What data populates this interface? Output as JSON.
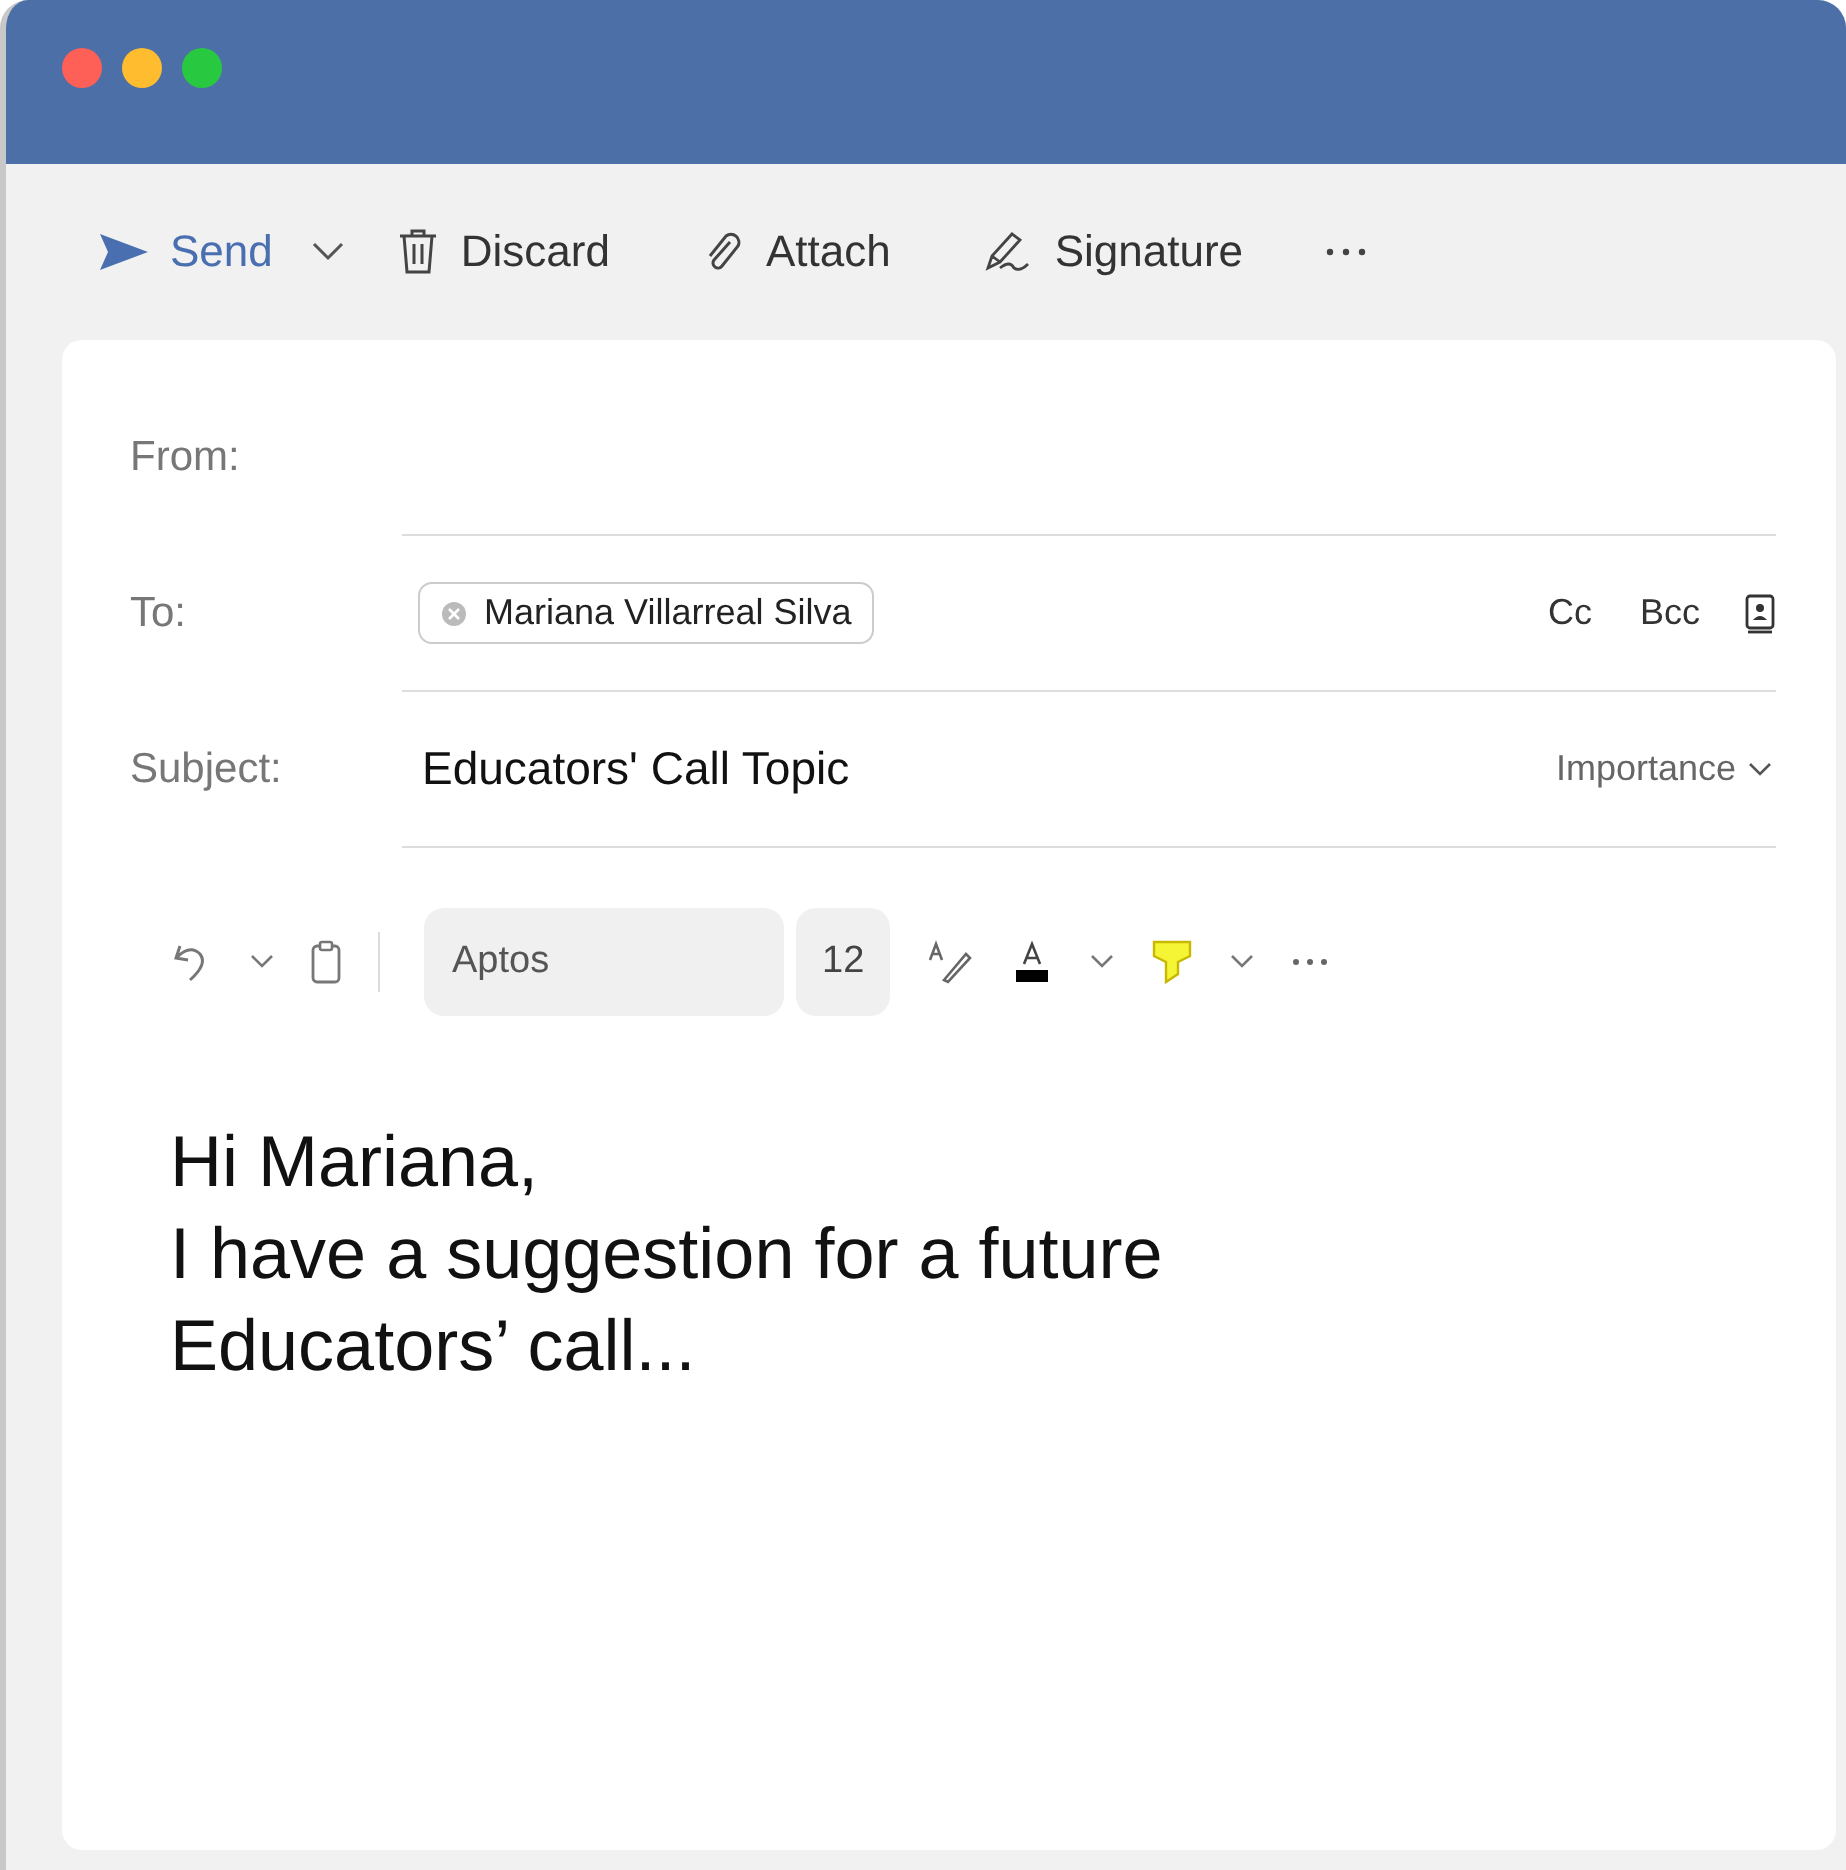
{
  "toolbar": {
    "send": "Send",
    "discard": "Discard",
    "attach": "Attach",
    "signature": "Signature"
  },
  "from": {
    "label": "From:"
  },
  "to": {
    "label": "To:",
    "recipients": [
      "Mariana Villarreal Silva"
    ],
    "cc": "Cc",
    "bcc": "Bcc"
  },
  "subject": {
    "label": "Subject:",
    "value": "Educators' Call Topic",
    "importance": "Importance"
  },
  "format": {
    "font": "Aptos",
    "size": "12"
  },
  "body": [
    "Hi Mariana,",
    "I have a suggestion for a future",
    "Educators’ call..."
  ]
}
